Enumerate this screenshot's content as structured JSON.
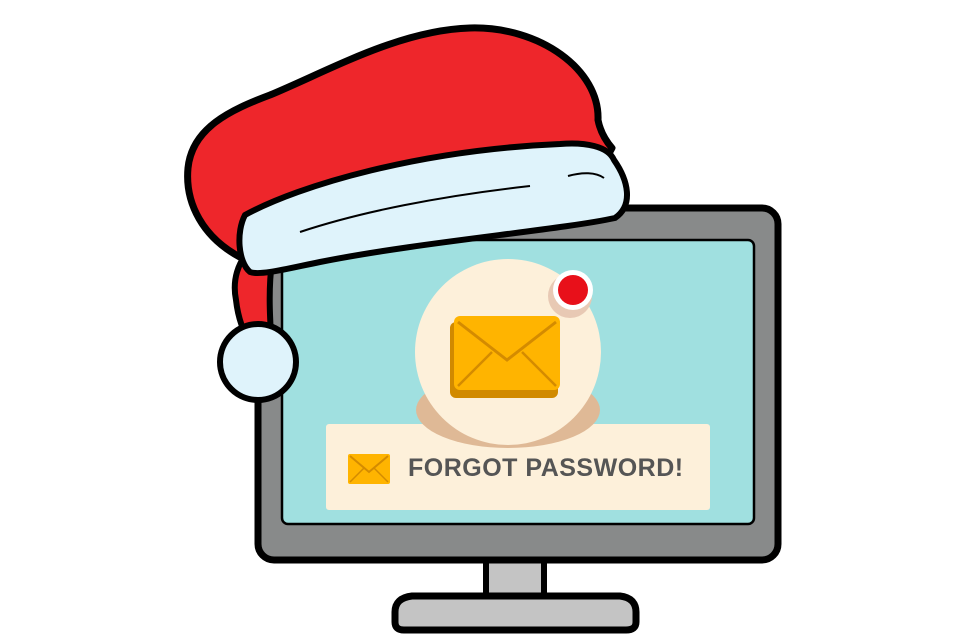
{
  "banner": {
    "label": "FORGOT PASSWORD!"
  },
  "icons": {
    "hero": "envelope-icon",
    "banner": "envelope-icon",
    "notification": "notification-dot",
    "hat": "santa-hat"
  },
  "colors": {
    "monitor_frame": "#888a8a",
    "screen": "#a0e0e0",
    "banner_bg": "#fdf0da",
    "envelope": "#ffb400",
    "notification": "#e8101a",
    "hat_red": "#ee262b",
    "hat_fur": "#dff3fb",
    "outline": "#000000"
  }
}
